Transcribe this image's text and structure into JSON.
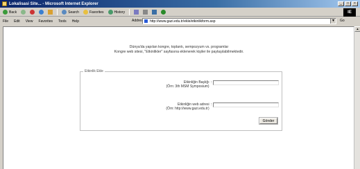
{
  "window": {
    "title": "Lokalisasi Site... - Microsoft Internet Explorer",
    "controls": [
      "_",
      "□",
      "×"
    ]
  },
  "toolbar": {
    "buttons": [
      {
        "label": "Back",
        "icon": "back-arrow-icon"
      },
      {
        "label": "",
        "icon": "forward-arrow-icon"
      },
      {
        "label": "",
        "icon": "stop-icon"
      },
      {
        "label": "",
        "icon": "refresh-icon"
      },
      {
        "label": "",
        "icon": "home-icon"
      },
      {
        "label": "Search",
        "icon": "search-icon"
      },
      {
        "label": "Favorites",
        "icon": "favorites-icon"
      },
      {
        "label": "History",
        "icon": "history-icon"
      }
    ],
    "logo": "IE"
  },
  "menubar": {
    "items": [
      "File",
      "Edit",
      "View",
      "Favorites",
      "Tools",
      "Help"
    ],
    "address_label": "Address",
    "address_value": "http://www.gazi.edu.tr/ekle/etkinlikform.asp",
    "go_label": "Go"
  },
  "page": {
    "intro_line1": "Dünya'da yapılan kongre, toplantı, sempozyum vs. programlar",
    "intro_line2": "Kongre web sitesi, \"Etkinlikler\" sayfasına eklenerek kişiler ile paylaşılabilmektedir.",
    "panel_legend": "Etkinlik Ekle",
    "fields": [
      {
        "label": "Etkinliğin Başlığı",
        "example": "(Örn: 3th MSM Symposium)",
        "value": ""
      },
      {
        "label": "Etkinliğin web adresi",
        "example": "(Örn: http://www.gazi.edu.tr)",
        "value": ""
      }
    ],
    "colon": ":",
    "submit_label": "Gönder"
  }
}
